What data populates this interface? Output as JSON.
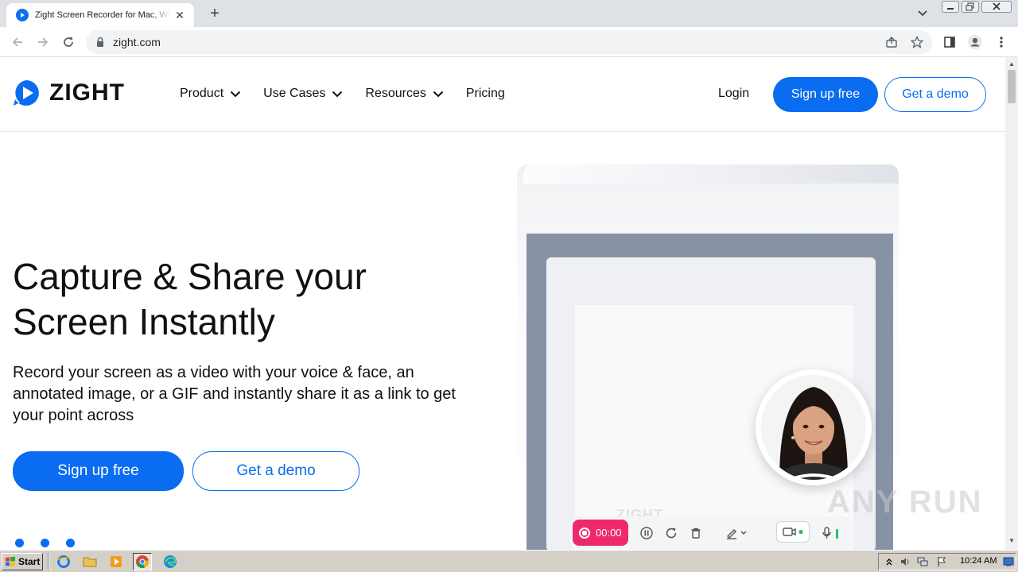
{
  "browser": {
    "tab_title": "Zight Screen Recorder for Mac, Windows",
    "tab_close": "✕",
    "new_tab": "+",
    "url": "zight.com"
  },
  "site": {
    "logo_text": "ZIGHT",
    "nav": [
      {
        "label": "Product"
      },
      {
        "label": "Use Cases"
      },
      {
        "label": "Resources"
      },
      {
        "label": "Pricing"
      }
    ],
    "login": "Login",
    "header_signup": "Sign up free",
    "header_demo": "Get a demo",
    "hero_title_line1": "Capture & Share your",
    "hero_title_line2": "Screen Instantly",
    "hero_subtitle": "Record your screen as a video with your voice & face, an annotated image, or a GIF and instantly share it as a link to get your point across",
    "hero_signup": "Sign up free",
    "hero_demo": "Get a demo",
    "recorder_time": "00:00",
    "paper_logo": "ZIGHT",
    "brand_color": "#0a6cf0",
    "record_color": "#ee2a6b"
  },
  "watermark": "ANY RUN",
  "taskbar": {
    "start": "Start",
    "clock": "10:24 AM",
    "apps": [
      "ie-icon",
      "folder-icon",
      "media-player-icon",
      "chrome-icon",
      "edge-icon"
    ]
  }
}
